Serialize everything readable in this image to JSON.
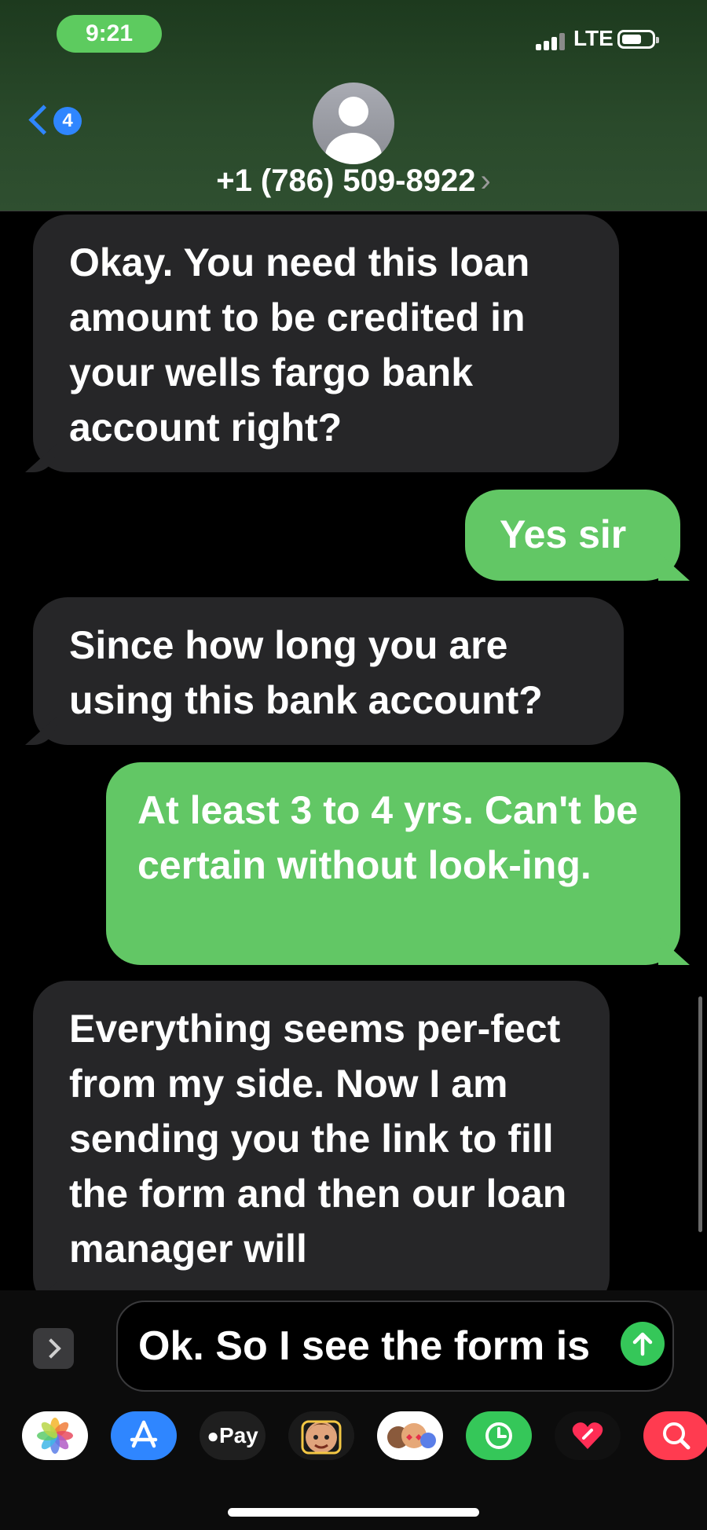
{
  "status_bar": {
    "time": "9:21",
    "network": "LTE"
  },
  "header": {
    "back_badge": "4",
    "contact": "+1 (786) 509-8922",
    "chevron": "›"
  },
  "messages": [
    {
      "direction": "incoming",
      "text": "Okay. You need this loan amount to be credited in your wells fargo bank account right?"
    },
    {
      "direction": "outgoing",
      "text": "Yes sir"
    },
    {
      "direction": "incoming",
      "text": "Since how long you are using this bank account?"
    },
    {
      "direction": "outgoing",
      "text": "At least 3 to 4 yrs. Can't be certain without look-ing."
    },
    {
      "direction": "incoming",
      "text": "Everything seems per-fect from my side. Now I am sending you the link to fill the form and then our loan manager will"
    }
  ],
  "composer": {
    "draft": "Ok. So I see the form is"
  },
  "app_strip": [
    {
      "name": "photos",
      "label": ""
    },
    {
      "name": "app-store",
      "label": ""
    },
    {
      "name": "apple-pay",
      "label": "Pay"
    },
    {
      "name": "memoji",
      "label": ""
    },
    {
      "name": "memoji-stickers",
      "label": ""
    },
    {
      "name": "screen-time",
      "label": ""
    },
    {
      "name": "digital-touch",
      "label": ""
    },
    {
      "name": "images-search",
      "label": ""
    }
  ],
  "colors": {
    "header_bg": "#2a4a2b",
    "incoming_bubble": "#262628",
    "outgoing_bubble": "#62c765",
    "accent_blue": "#2f86ff",
    "send_green": "#35c759"
  }
}
